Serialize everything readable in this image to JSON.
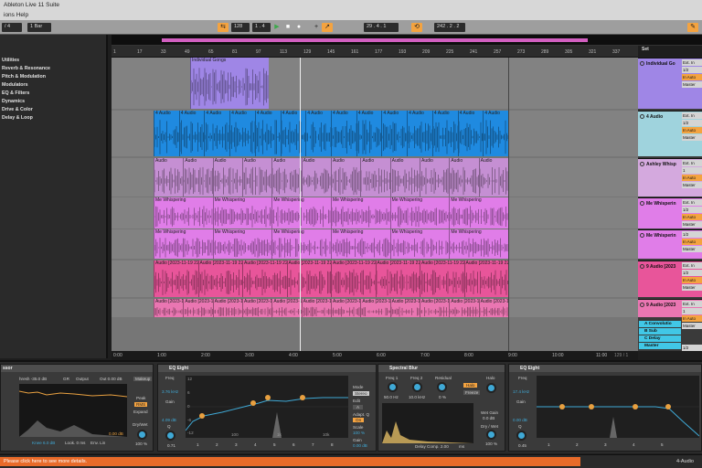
{
  "app": {
    "title": "Ableton Live 11 Suite",
    "menu": "ions  Help"
  },
  "transport": {
    "left_meter": "/ 4",
    "quantize": "1 Bar",
    "tempo": "128",
    "meter": "1 . 4",
    "position": "29 . 4 . 1",
    "loop_length": "242 . 2 . 2"
  },
  "browser": {
    "items": [
      "Utilities",
      "Reverb & Resonance",
      "Pitch & Modulation",
      "Modulators",
      "EQ & Filters",
      "Dynamics",
      "Drive & Color",
      "Delay & Loop"
    ]
  },
  "ruler": {
    "bars": [
      "1",
      "17",
      "33",
      "49",
      "65",
      "81",
      "97",
      "113",
      "129",
      "145",
      "161",
      "177",
      "193",
      "209",
      "225",
      "241",
      "257",
      "273",
      "289",
      "305",
      "321",
      "337"
    ]
  },
  "timebar": {
    "times": [
      "0:00",
      "1:00",
      "2:00",
      "3:00",
      "4:00",
      "5:00",
      "6:00",
      "7:00",
      "8:00",
      "9:00",
      "10:00",
      "11:00"
    ],
    "position": "129 / 1"
  },
  "lanes": [
    {
      "clip_label": "Individual Gongs",
      "color": "#9f86e6"
    },
    {
      "clip_label": "4 Audio",
      "color": "#1f8ae0"
    },
    {
      "clip_label": "Audio",
      "color": "#c58fd3"
    },
    {
      "clip_label": "Me Whispering",
      "color": "#e07de8"
    },
    {
      "clip_label": "Me Whispering",
      "color": "#e07de8"
    },
    {
      "clip_label": "Audio [2023-11-19 222",
      "color": "#e8559a"
    },
    {
      "clip_label": "Audio [2023-11-19 222808",
      "color": "#ea76b2"
    }
  ],
  "tracks": {
    "set_label": "Set",
    "items": [
      {
        "name": "Individual Go",
        "color": "#9f86e6",
        "io": [
          "Ext. In",
          "1/2",
          "In Auto",
          "Master"
        ]
      },
      {
        "name": "4 Audio",
        "color": "#9fd3dd",
        "io": [
          "Ext. In",
          "1/2",
          "In Auto",
          "Master"
        ]
      },
      {
        "name": "Ashley Whisp",
        "color": "#d4a9de",
        "io": [
          "Ext. In",
          "1",
          "In Auto",
          "Master"
        ]
      },
      {
        "name": "Me Whisperin",
        "color": "#e07de8",
        "io": [
          "Ext. In",
          "1/2",
          "In Auto",
          "Master"
        ]
      },
      {
        "name": "Me Whisperin",
        "color": "#e07de8",
        "io": [
          "1/2",
          "In Auto",
          "Master"
        ]
      },
      {
        "name": "9 Audio [2023",
        "color": "#e8559a",
        "io": [
          "Ext. In",
          "1/2",
          "In Auto",
          "Master"
        ]
      },
      {
        "name": "9 Audio [2023",
        "color": "#ea76b2",
        "io": [
          "Ext. In",
          "1",
          "In Auto",
          "Master"
        ]
      }
    ],
    "returns": [
      "A Convolutio",
      "B Sub",
      "C Delay",
      "Master"
    ],
    "master_io": "1/2"
  },
  "devices": {
    "comp": {
      "title": "ssor",
      "thresh": "hresh -35.0 dB",
      "gr": "GR",
      "output": "Output",
      "out": "Out 0.00 dB",
      "makeup": "Makeup",
      "peak": "Peak",
      "rms": "RMS",
      "expand": "Expand",
      "knee": "Knee 6.0 dB",
      "look": "Look. 0 ms",
      "env": "Env. Lin",
      "drywet": "Dry/Wet",
      "dw_val": "100 %",
      "gain_val": "0.00 dB"
    },
    "eq1": {
      "title": "EQ Eight",
      "freq": "Freq",
      "freq_val": "3.76 kHz",
      "gain": "Gain",
      "gain_val": "4.09 dB",
      "q": "Q",
      "q_val": "0.71",
      "mode": "Mode",
      "mode_val": "Stereo",
      "edit": "Edit",
      "edit_val": "A",
      "adapt": "Adapt. Q",
      "adapt_val": "On",
      "scale": "Scale",
      "scale_val": "100 %",
      "outgain": "Gain",
      "outgain_val": "0.00 dB",
      "bands": [
        "1",
        "2",
        "3",
        "4",
        "5",
        "6",
        "7",
        "8"
      ],
      "yticks": [
        "12",
        "6",
        "0",
        "-6",
        "-12"
      ],
      "xticks": [
        "100",
        "1k",
        "10k"
      ]
    },
    "blur": {
      "title": "Spectral Blur",
      "freq1": "Freq 1",
      "freq1_val": "50.0 Hz",
      "freq2": "Freq 2",
      "freq2_val": "10.0 kHz",
      "residual": "Residual",
      "res_val": "0 %",
      "halo": "Halo",
      "halo_val": "Halo",
      "freeze": "Freeze",
      "wetgain": "Wet Gain",
      "wetgain_val": "0.0 dB",
      "drywet": "Dry / Wet",
      "dw_val": "100 %",
      "delay": "Delay Comp. 2.00",
      "mode": "ms"
    },
    "eq2": {
      "title": "EQ Eight",
      "freq": "Freq",
      "freq_val": "17.4 kHz",
      "gain": "Gain",
      "gain_val": "0.00 dB",
      "q": "Q",
      "q_val": "0.45",
      "bands": [
        "1",
        "2",
        "3",
        "4",
        "5"
      ]
    }
  },
  "status": {
    "message": "Please click here to see more details.",
    "track": "4-Audio"
  }
}
